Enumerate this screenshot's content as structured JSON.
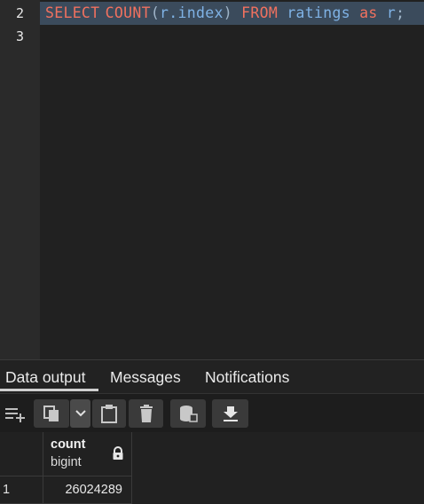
{
  "editor": {
    "line_numbers": [
      "2",
      "3"
    ],
    "query_tokens": {
      "select": "SELECT",
      "count": "COUNT",
      "open_paren": "(",
      "arg": "r.index",
      "close_paren": ")",
      "from": "FROM",
      "table": "ratings",
      "as": "as",
      "alias": "r",
      "semicolon": ";"
    }
  },
  "tabs": [
    {
      "label": "Data output"
    },
    {
      "label": "Messages"
    },
    {
      "label": "Notifications"
    }
  ],
  "toolbar": {
    "icons": [
      "add-row-icon",
      "copy-icon",
      "chevron-down-icon",
      "paste-icon",
      "delete-icon",
      "save-data-icon",
      "download-icon"
    ]
  },
  "grid": {
    "columns": [
      {
        "name": "count",
        "type": "bigint"
      }
    ],
    "rows": [
      {
        "num": "1",
        "values": [
          "26024289"
        ]
      }
    ]
  },
  "colors": {
    "keyword": "#f0715f",
    "identifier": "#7fb2e5",
    "selection": "#3b4b5c",
    "background": "#222222"
  }
}
